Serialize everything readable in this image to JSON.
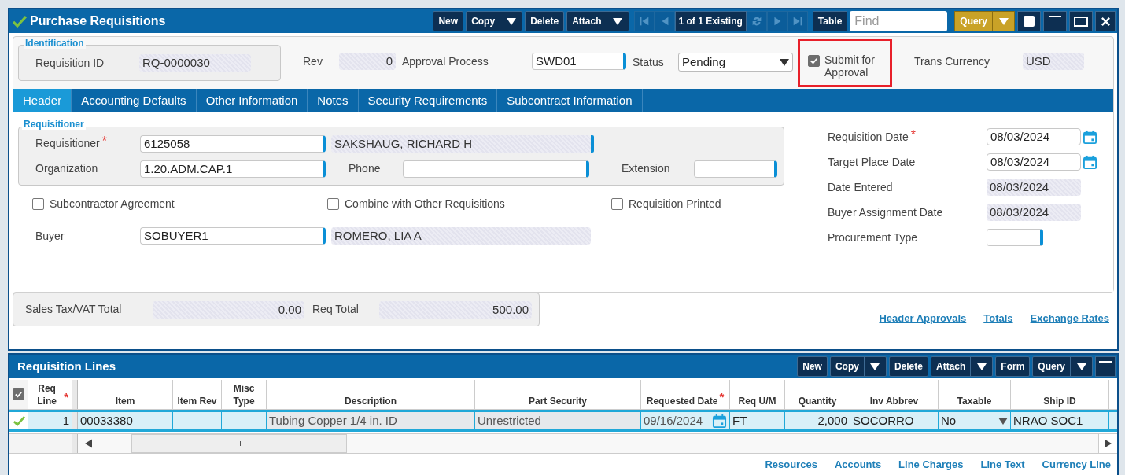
{
  "window": {
    "title": "Purchase Requisitions",
    "toolbar": [
      {
        "label": "New",
        "menu": false
      },
      {
        "label": "Copy",
        "menu": true
      },
      {
        "label": "Delete",
        "menu": false
      },
      {
        "label": "Attach",
        "menu": true
      }
    ],
    "navigator": {
      "before": [
        {
          "kind": "first",
          "disabled": true
        },
        {
          "kind": "previous",
          "disabled": true
        }
      ],
      "record": "1 of 1 Existing",
      "after": [
        {
          "kind": "refresh",
          "disabled": true
        },
        {
          "kind": "next",
          "disabled": true
        },
        {
          "kind": "last",
          "disabled": true
        }
      ]
    },
    "view_button": "Table",
    "find": {
      "placeholder": "Find"
    },
    "query": {
      "label": "Query",
      "menu": true
    }
  },
  "identification": {
    "legend": "Identification",
    "label": "Requisition ID",
    "value": "RQ-0000030",
    "kind": "readonly"
  },
  "header_fields": [
    {
      "label": "Rev",
      "value": "0",
      "kind": "amount"
    },
    {
      "label": "Approval Process",
      "value": "SWD01",
      "kind": "lookup"
    },
    {
      "label": "Status",
      "value": "Pending",
      "kind": "select"
    },
    {
      "label": "Submit for Approval",
      "kind": "checkbox",
      "checked": true,
      "highlighted": true
    },
    {
      "label": "Trans Currency",
      "value": "USD",
      "kind": "readonly"
    }
  ],
  "tabs": [
    {
      "label": "Header",
      "selected": true
    },
    {
      "label": "Accounting Defaults",
      "selected": false
    },
    {
      "label": "Other Information",
      "selected": false
    },
    {
      "label": "Notes",
      "selected": false
    },
    {
      "label": "Security Requirements",
      "selected": false
    },
    {
      "label": "Subcontract Information",
      "selected": false
    }
  ],
  "requisitioner": {
    "legend": "Requisitioner",
    "requisitioner": {
      "label": "Requisitioner",
      "required_mark": "*",
      "value": "6125058",
      "kind": "lookup",
      "name": "SAKSHAUG, RICHARD H"
    },
    "organization": {
      "label": "Organization",
      "value": "1.20.ADM.CAP.1",
      "kind": "lookup"
    },
    "phone": {
      "label": "Phone",
      "kind": "lookup"
    },
    "extension": {
      "label": "Extension",
      "kind": "lookup"
    }
  },
  "checkboxes": [
    {
      "label": "Subcontractor Agreement",
      "checked": false
    },
    {
      "label": "Combine with Other Requisitions",
      "checked": false
    },
    {
      "label": "Requisition Printed",
      "checked": false
    }
  ],
  "buyer": {
    "label": "Buyer",
    "value": "SOBUYER1",
    "kind": "lookup",
    "name": "ROMERO, LIA A"
  },
  "dates": [
    {
      "label": "Requisition Date",
      "required_mark": "*",
      "value": "08/03/2024",
      "kind": "date"
    },
    {
      "label": "Target Place Date",
      "value": "08/03/2024",
      "kind": "date"
    },
    {
      "label": "Date Entered",
      "value": "08/03/2024",
      "kind": "readonly"
    },
    {
      "label": "Buyer Assignment Date",
      "value": "08/03/2024",
      "kind": "readonly"
    },
    {
      "label": "Procurement Type",
      "kind": "lookup"
    }
  ],
  "totals": [
    {
      "label": "Sales Tax/VAT Total",
      "value": "0.00"
    },
    {
      "label": "Req Total",
      "value": "500.00"
    }
  ],
  "header_links": [
    "Header Approvals",
    "Totals",
    "Exchange Rates"
  ],
  "lines": {
    "title": "Requisition Lines",
    "toolbar": [
      {
        "label": "New",
        "menu": false
      },
      {
        "label": "Copy",
        "menu": true
      },
      {
        "label": "Delete",
        "menu": false
      },
      {
        "label": "Attach",
        "menu": true
      },
      {
        "label": "Form",
        "menu": false
      },
      {
        "label": "Query",
        "menu": true
      }
    ],
    "select_all": {
      "checked": true
    },
    "columns": [
      {
        "label": "Req Line",
        "required_mark": "*",
        "kind": "number"
      },
      {
        "label": "Item",
        "kind": "text"
      },
      {
        "label": "Item Rev",
        "kind": "text"
      },
      {
        "label": "Misc Type",
        "kind": "text"
      },
      {
        "label": "Description",
        "kind": "readonly"
      },
      {
        "label": "Part Security",
        "kind": "readonly"
      },
      {
        "label": "Requested Date",
        "required_mark": "*",
        "kind": "date"
      },
      {
        "label": "Req U/M",
        "kind": "text"
      },
      {
        "label": "Quantity",
        "kind": "number"
      },
      {
        "label": "Inv Abbrev",
        "kind": "text"
      },
      {
        "label": "Taxable",
        "kind": "select"
      },
      {
        "label": "Ship ID",
        "kind": "text"
      }
    ],
    "rows": [
      {
        "selected": true,
        "cells": [
          "1",
          "00033380",
          "",
          "",
          "Tubing  Copper 1/4 in. ID",
          "Unrestricted",
          "09/16/2024",
          "FT",
          "2,000",
          "SOCORRO",
          "No",
          "NRAO SOC1"
        ]
      }
    ],
    "links": [
      "Resources",
      "Accounts",
      "Line Charges",
      "Line Text",
      "Currency Line"
    ]
  }
}
